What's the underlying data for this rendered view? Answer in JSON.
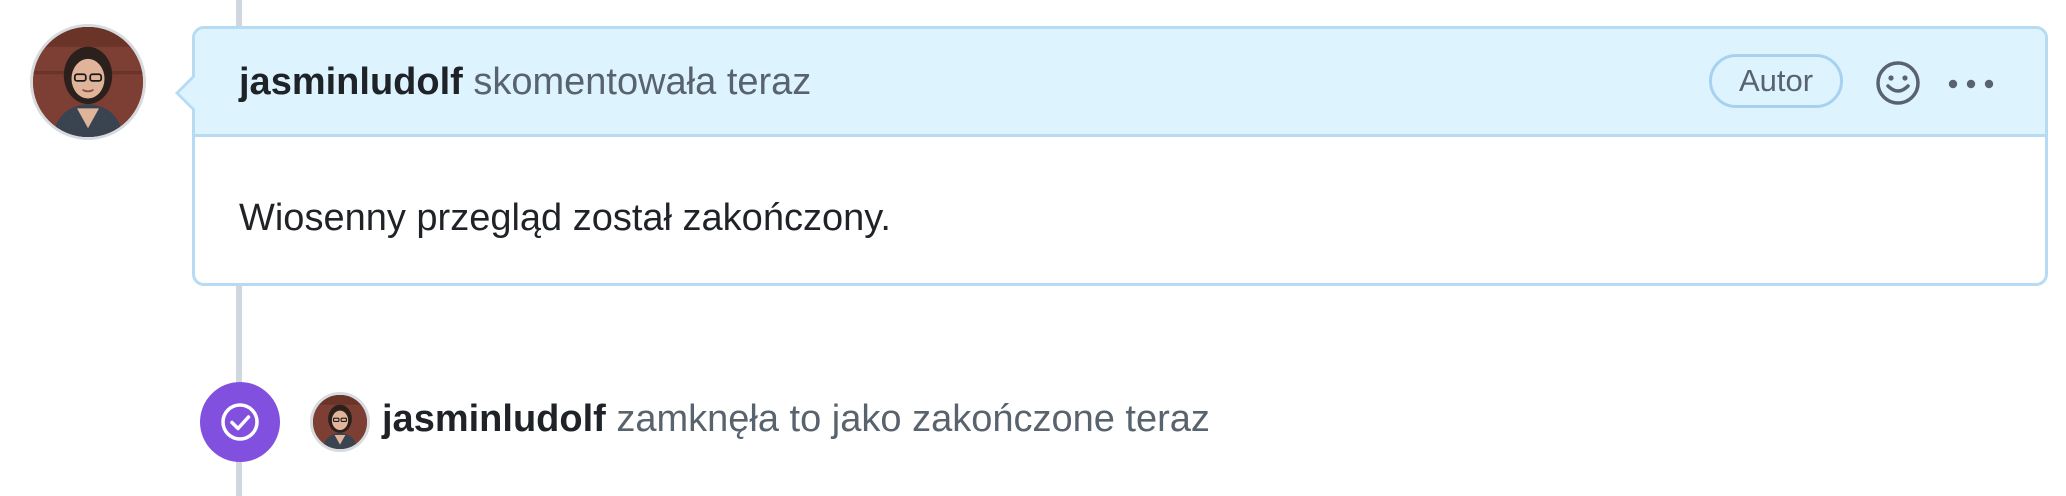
{
  "comment": {
    "author": "jasminludolf",
    "action": "skomentowała teraz",
    "badge": "Autor",
    "body": "Wiosenny przegląd został zakończony.",
    "reaction_icon": "smiley-icon",
    "more_icon": "kebab-horizontal-icon"
  },
  "event": {
    "author": "jasminludolf",
    "action": "zamknęła to jako zakończone teraz",
    "icon": "check-circle-icon"
  },
  "colors": {
    "header_bg": "#ddf4ff",
    "header_border": "#b6dbf3",
    "closed_accent": "#8250df",
    "muted_text": "#59636e",
    "timeline": "#d0d7de"
  }
}
